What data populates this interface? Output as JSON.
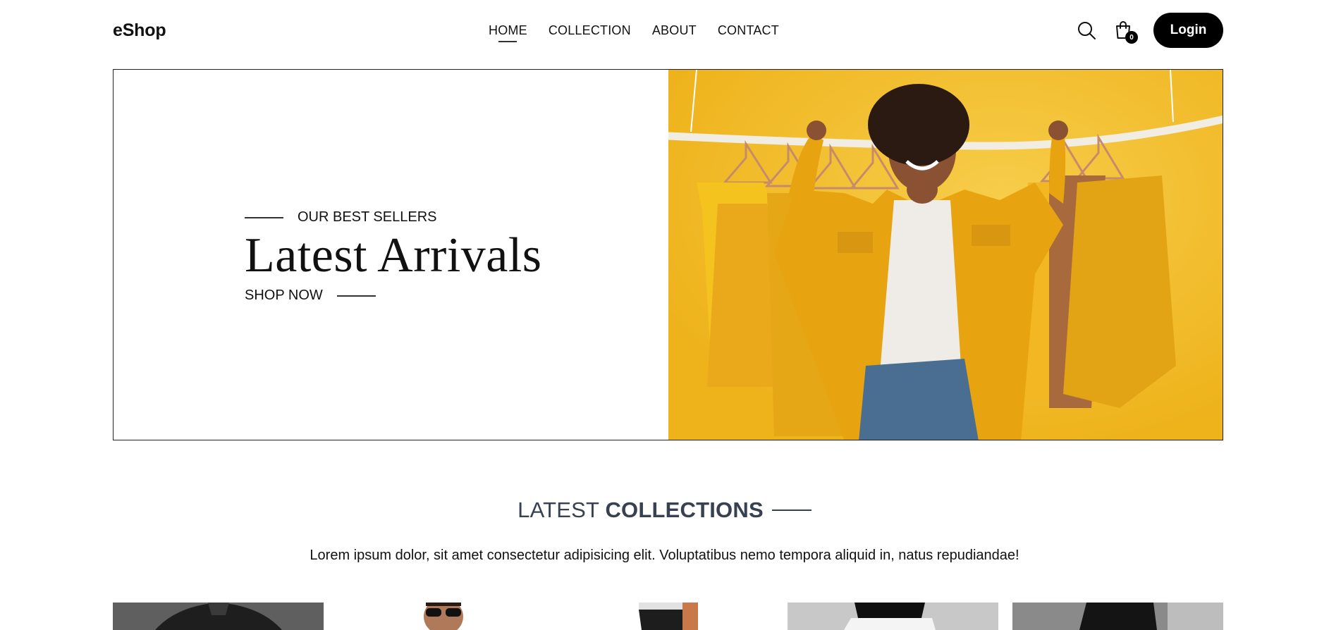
{
  "brand": {
    "logo": "eShop"
  },
  "nav": {
    "items": [
      {
        "label": "HOME",
        "active": true
      },
      {
        "label": "COLLECTION",
        "active": false
      },
      {
        "label": "ABOUT",
        "active": false
      },
      {
        "label": "CONTACT",
        "active": false
      }
    ],
    "search_icon": "search-icon",
    "cart_icon": "shopping-bag-icon",
    "cart_count": "0",
    "login_label": "Login"
  },
  "hero": {
    "subtitle": "OUR BEST SELLERS",
    "title": "Latest Arrivals",
    "cta": "SHOP NOW",
    "image_bg": "#f2b820"
  },
  "collections": {
    "heading_light": "LATEST",
    "heading_bold": "COLLECTIONS",
    "description": "Lorem ipsum dolor, sit amet consectetur adipisicing elit. Voluptatibus nemo tempora aliquid in, natus repudiandae!",
    "products": [
      {
        "image": "product-image-black-jacket"
      },
      {
        "image": "product-image-man-sunglasses"
      },
      {
        "image": "product-image-trousers"
      },
      {
        "image": "product-image-black-white-top"
      },
      {
        "image": "product-image-black-outfit"
      }
    ]
  },
  "colors": {
    "accent": "#000000",
    "heading": "#374151",
    "hero_yellow": "#f2b820"
  }
}
